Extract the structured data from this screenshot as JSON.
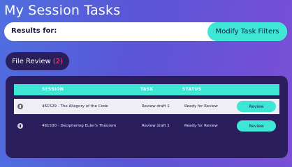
{
  "page": {
    "title": "My Session Tasks"
  },
  "results_bar": {
    "label": "Results for:",
    "filter_button": "Modify Task Filters"
  },
  "tab": {
    "label": "File Review",
    "count": "(2)"
  },
  "table": {
    "headers": [
      "SESSION",
      "TASK",
      "STATUS"
    ],
    "rows": [
      {
        "session": "461529 - The Allegory of the Code",
        "task": "Review draft 1",
        "status": "Ready for Review",
        "action": "Review",
        "icon": "info-icon"
      },
      {
        "session": "461530 - Deciphering Euler's Theorem",
        "task": "Review draft 1",
        "status": "Ready for Review",
        "action": "Review",
        "icon": "info-icon"
      }
    ]
  },
  "colors": {
    "accent": "#3ee6d5",
    "panel": "#2a1f5c",
    "count": "#ff4d82"
  }
}
